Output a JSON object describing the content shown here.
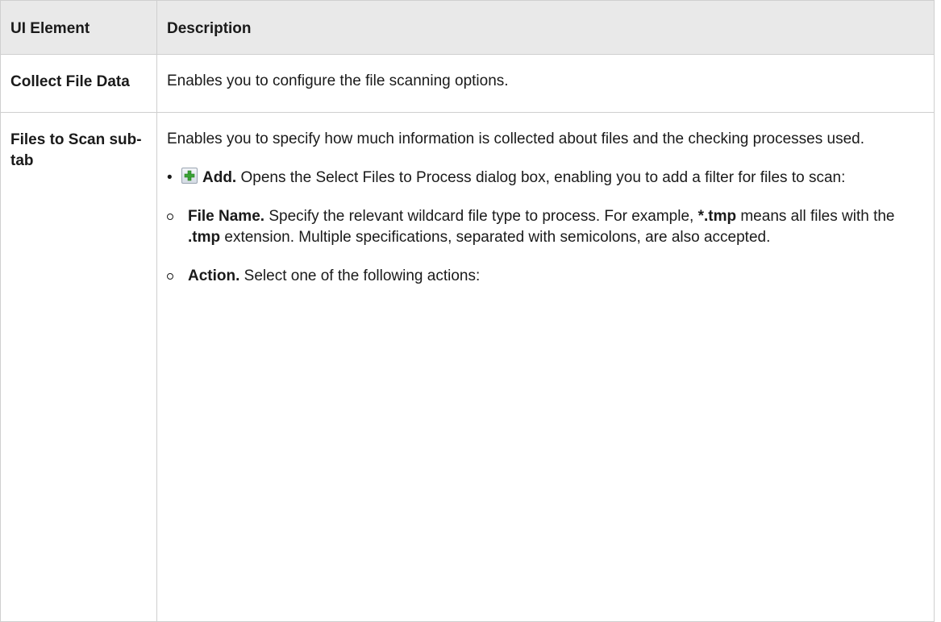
{
  "table": {
    "headers": [
      "UI Element",
      "Description"
    ],
    "rows": [
      {
        "element": "Collect File Data",
        "description": "Enables you to configure the file scanning options."
      },
      {
        "element": "Files to Scan sub-tab",
        "description": "Enables you to specify how much information is collected about files and the checking processes used.",
        "bullet": {
          "icon": "add-icon",
          "label": "Add.",
          "text": " Opens the Select Files to Process dialog box, enabling you to add a filter for files to scan:"
        },
        "sub_items": [
          {
            "label": "File Name.",
            "text_1": " Specify the relevant wildcard file type to process. For example, ",
            "bold_1": "*.tmp",
            "text_2": " means all files with the ",
            "bold_2": ".tmp",
            "text_3": " extension. Multiple specifications, separated with semicolons, are also accepted."
          },
          {
            "label": "Action.",
            "text_1": " Select one of the following actions:"
          }
        ]
      }
    ]
  }
}
